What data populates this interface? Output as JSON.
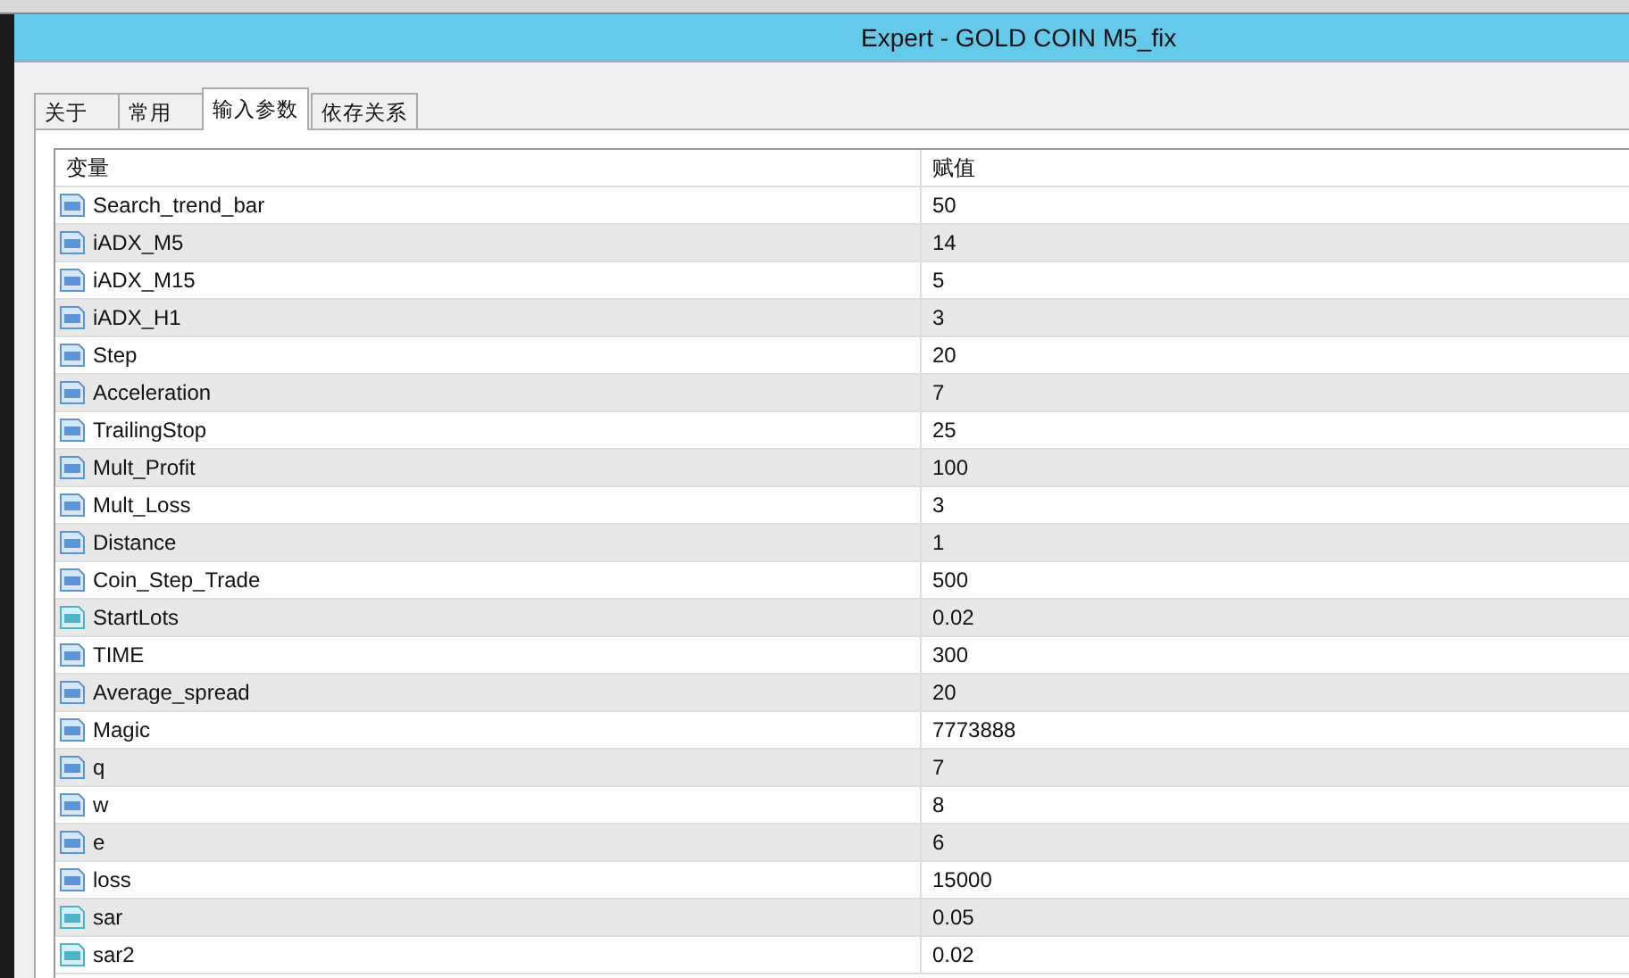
{
  "window": {
    "title": "Expert - GOLD COIN M5_fix"
  },
  "tabs": [
    {
      "label": "关于",
      "selected": false
    },
    {
      "label": "常用",
      "selected": false
    },
    {
      "label": "输入参数",
      "selected": true
    },
    {
      "label": "依存关系",
      "selected": false
    }
  ],
  "table": {
    "columns": [
      "变量",
      "赋值"
    ],
    "rows": [
      {
        "kind": "int",
        "name": "Search_trend_bar",
        "value": "50"
      },
      {
        "kind": "int",
        "name": "iADX_M5",
        "value": "14"
      },
      {
        "kind": "int",
        "name": "iADX_M15",
        "value": "5"
      },
      {
        "kind": "int",
        "name": "iADX_H1",
        "value": "3"
      },
      {
        "kind": "int",
        "name": "Step",
        "value": "20"
      },
      {
        "kind": "int",
        "name": "Acceleration",
        "value": "7"
      },
      {
        "kind": "int",
        "name": "TrailingStop",
        "value": "25"
      },
      {
        "kind": "int",
        "name": "Mult_Profit",
        "value": "100"
      },
      {
        "kind": "int",
        "name": "Mult_Loss",
        "value": "3"
      },
      {
        "kind": "int",
        "name": "Distance",
        "value": "1"
      },
      {
        "kind": "int",
        "name": "Coin_Step_Trade",
        "value": "500"
      },
      {
        "kind": "double",
        "name": "StartLots",
        "value": "0.02"
      },
      {
        "kind": "int",
        "name": "TIME",
        "value": "300"
      },
      {
        "kind": "int",
        "name": "Average_spread",
        "value": "20"
      },
      {
        "kind": "int",
        "name": "Magic",
        "value": "7773888"
      },
      {
        "kind": "int",
        "name": "q",
        "value": "7"
      },
      {
        "kind": "int",
        "name": "w",
        "value": "8"
      },
      {
        "kind": "int",
        "name": "e",
        "value": "6"
      },
      {
        "kind": "int",
        "name": "loss",
        "value": "15000"
      },
      {
        "kind": "double",
        "name": "sar",
        "value": "0.05"
      },
      {
        "kind": "double",
        "name": "sar2",
        "value": "0.02"
      }
    ]
  }
}
